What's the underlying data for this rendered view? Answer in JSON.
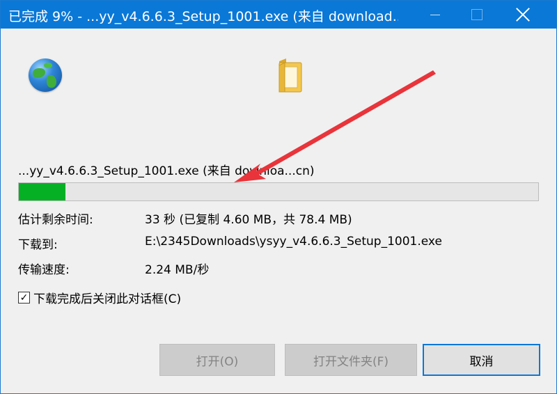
{
  "window": {
    "title": "已完成 9% - ...yy_v4.6.6.3_Setup_1001.exe (来自 download..."
  },
  "download": {
    "file_label": "...yy_v4.6.6.3_Setup_1001.exe (来自 downloa...cn)",
    "progress_percent": 9,
    "remaining_label": "估计剩余时间:",
    "remaining_value": "33 秒 (已复制 4.60 MB，共 78.4 MB)",
    "destination_label": "下载到:",
    "destination_value": "E:\\2345Downloads\\ysyy_v4.6.6.3_Setup_1001.exe",
    "speed_label": "传输速度:",
    "speed_value": "2.24 MB/秒"
  },
  "options": {
    "close_when_done_label": "下载完成后关闭此对话框(C)",
    "close_when_done_checked": true,
    "check_mark": "✓"
  },
  "buttons": {
    "open": "打开(O)",
    "open_folder": "打开文件夹(F)",
    "cancel": "取消"
  },
  "icons": {
    "file_type": "globe-icon",
    "folder": "folder-icon"
  },
  "colors": {
    "titlebar": "#0a78d7",
    "progress": "#06b025",
    "annotation_arrow": "#e8343a"
  }
}
